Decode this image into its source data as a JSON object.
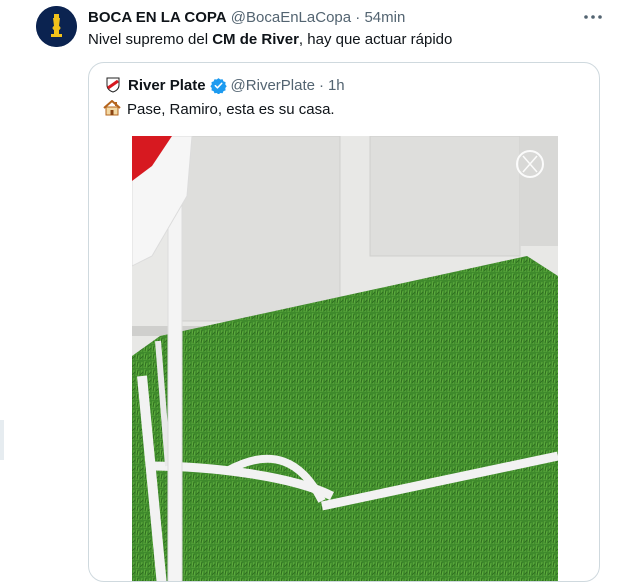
{
  "tweet": {
    "display_name": "BOCA EN LA COPA",
    "handle": "@BocaEnLaCopa",
    "separator": "·",
    "time": "54min",
    "more_icon": "more-horizontal-icon",
    "text_part1": "Nivel supremo del ",
    "text_bold": "CM de River",
    "text_part2": ", hay que actuar rápido"
  },
  "quote": {
    "display_name": "River Plate",
    "handle": "@RiverPlate",
    "separator": "·",
    "time": "1h",
    "verified": true,
    "verified_icon": "verified-badge-icon",
    "emoji_icon": "house-icon",
    "text": "Pase, Ramiro, esta es su casa.",
    "media_watermark": "river-plate-logo-watermark",
    "media_description_icon": "photo"
  },
  "colors": {
    "text": "#0f1419",
    "muted": "#536471",
    "border": "#cfd9de",
    "verified": "#1d9bf0",
    "avatar_bg": "#0b2350",
    "avatar_gold": "#f2c21b"
  }
}
